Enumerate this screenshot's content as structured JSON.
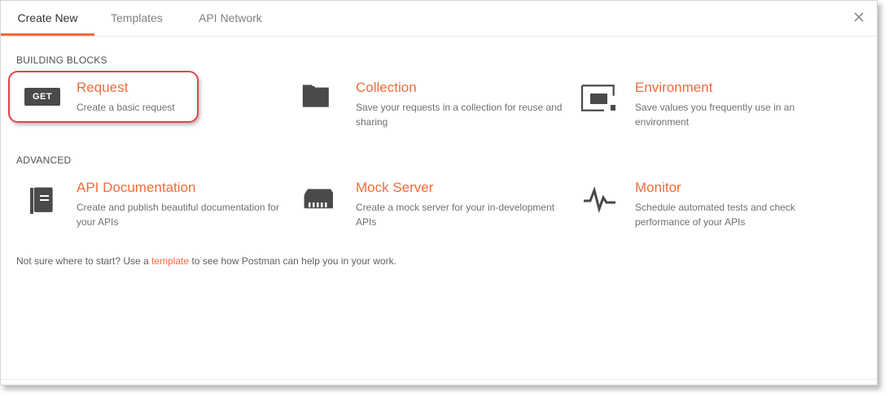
{
  "tabs": [
    {
      "label": "Create New",
      "active": true
    },
    {
      "label": "Templates",
      "active": false
    },
    {
      "label": "API Network",
      "active": false
    }
  ],
  "sections": {
    "building_blocks": "BUILDING BLOCKS",
    "advanced": "ADVANCED"
  },
  "cards": {
    "request": {
      "title": "Request",
      "desc": "Create a basic request",
      "badge": "GET",
      "icon": "get-badge-icon"
    },
    "collection": {
      "title": "Collection",
      "desc": "Save your requests in a collection for reuse and sharing",
      "icon": "folder-icon"
    },
    "environment": {
      "title": "Environment",
      "desc": "Save values you frequently use in an environment",
      "icon": "environment-icon"
    },
    "api_documentation": {
      "title": "API Documentation",
      "desc": "Create and publish beautiful documentation for your APIs",
      "icon": "document-icon"
    },
    "mock_server": {
      "title": "Mock Server",
      "desc": "Create a mock server for your in-development APIs",
      "icon": "server-icon"
    },
    "monitor": {
      "title": "Monitor",
      "desc": "Schedule automated tests and check performance of your APIs",
      "icon": "pulse-icon"
    }
  },
  "hint": {
    "before": "Not sure where to start? Use a ",
    "link": "template",
    "after": " to see how Postman can help you in your work."
  },
  "colors": {
    "accent": "#f26b3a",
    "highlight_border": "#e0454a",
    "icon_dark": "#4a4a4a"
  }
}
